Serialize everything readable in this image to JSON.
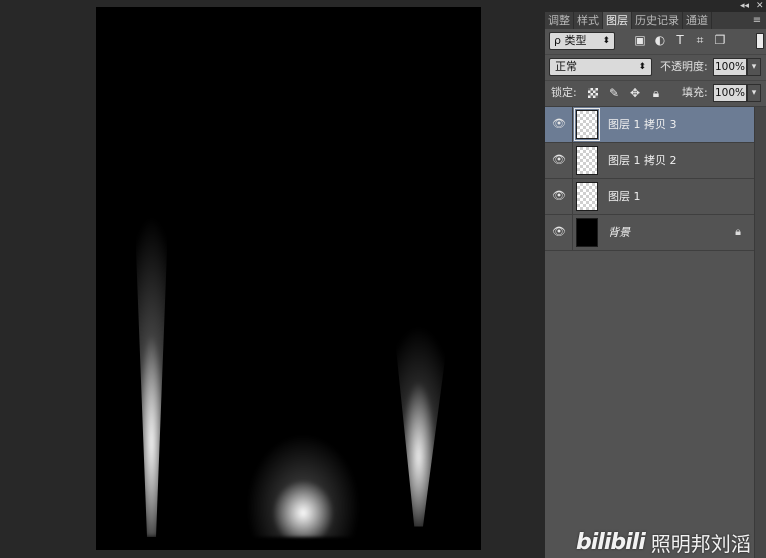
{
  "panel": {
    "tabs": [
      {
        "label": "调整",
        "active": false
      },
      {
        "label": "样式",
        "active": false
      },
      {
        "label": "图层",
        "active": true
      },
      {
        "label": "历史记录",
        "active": false
      },
      {
        "label": "通道",
        "active": false
      }
    ],
    "topbar": {
      "collapse": "◂◂",
      "close": "✕"
    },
    "menu_icon": "≡",
    "filter": {
      "kind_label": "ρ 类型",
      "icons": [
        "image-filter-icon",
        "adjustment-filter-icon",
        "type-filter-icon",
        "shape-filter-icon",
        "smart-object-filter-icon"
      ]
    },
    "blend": {
      "mode": "正常",
      "opacity_label": "不透明度:",
      "opacity_value": "100%"
    },
    "lock": {
      "label": "锁定:",
      "fill_label": "填充:",
      "fill_value": "100%"
    },
    "layers": [
      {
        "name": "图层 1 拷贝 3",
        "selected": true,
        "thumb": "transparent",
        "locked": false
      },
      {
        "name": "图层 1 拷贝 2",
        "selected": false,
        "thumb": "transparent",
        "locked": false
      },
      {
        "name": "图层 1",
        "selected": false,
        "thumb": "transparent",
        "locked": false
      },
      {
        "name": "背景",
        "selected": false,
        "thumb": "black",
        "locked": true
      }
    ]
  },
  "watermark": {
    "logo": "bilibili",
    "text": "照明邦刘滔"
  },
  "colors": {
    "panel_bg": "#535353",
    "selected_layer": "#6c7c94",
    "workspace_bg": "#282828",
    "canvas_bg": "#000000"
  }
}
